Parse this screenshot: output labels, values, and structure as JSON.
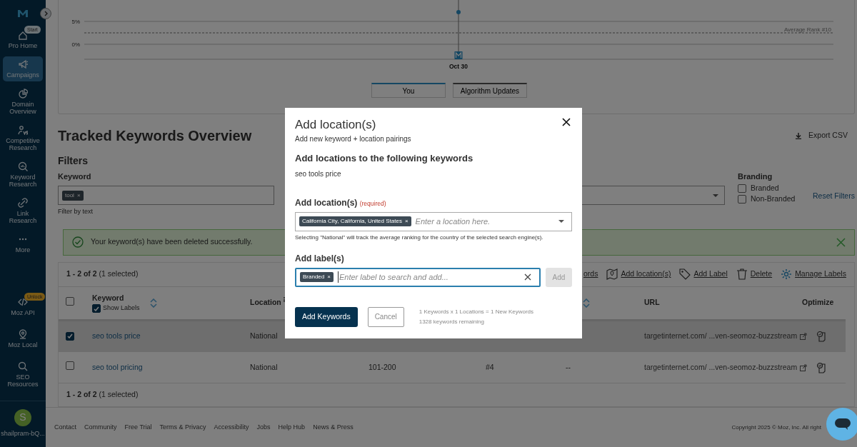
{
  "sidebar": {
    "items": [
      {
        "label": "Pro Home",
        "badge": {
          "text": "Start",
          "highlighted": false
        },
        "selected": false
      },
      {
        "label": "Campaigns",
        "selected": true
      },
      {
        "label": "Domain Overview",
        "selected": false
      },
      {
        "label": "Competitive Research",
        "selected": false
      },
      {
        "label": "Keyword Research",
        "selected": false
      },
      {
        "label": "Link Research",
        "selected": false
      },
      {
        "label": "More",
        "selected": false
      }
    ],
    "bottom_items": [
      {
        "label": "Moz API",
        "badge": {
          "text": "Unlock",
          "highlighted": true
        },
        "selected": false
      },
      {
        "label": "Moz Local",
        "selected": false
      },
      {
        "label": "SEO Resources",
        "selected": false
      }
    ],
    "user": {
      "initial": "S",
      "name": "shailpram-bQ..."
    }
  },
  "chart": {
    "y_ticks": [
      "5%",
      "0%"
    ],
    "date": "Oct 30",
    "reference_label": "Average Rank #10",
    "legend": [
      {
        "label": "You",
        "selected": true
      },
      {
        "label": "Algorithm Updates",
        "selected": false
      }
    ]
  },
  "page": {
    "title": "Tracked Keywords Overview",
    "export": "Export CSV"
  },
  "filters": {
    "heading": "Filters",
    "keyword": {
      "label": "Keyword",
      "chips": [
        {
          "text": "tool",
          "remove": "×"
        }
      ],
      "hint": "Filter by text"
    },
    "branding": {
      "label": "Branding",
      "options": [
        {
          "label": "Branded",
          "checked": false
        },
        {
          "label": "Non-Branded",
          "checked": false
        }
      ]
    },
    "reset": "Reset Filters"
  },
  "alert": {
    "message": "Your keyword(s) have been deleted successfully."
  },
  "table": {
    "count": "1 - 2 of 2",
    "selected_count": "(1 selected)",
    "toolbar": [
      {
        "label": "ords"
      },
      {
        "label": "Add location(s)"
      },
      {
        "label": "Add Label"
      },
      {
        "label": "Delete"
      },
      {
        "label": "Manage Labels"
      }
    ],
    "all_checked": false,
    "show_labels": {
      "label": "Show Labels",
      "checked": true
    },
    "columns": [
      "Keyword",
      "Location",
      "URL",
      "Optimize"
    ],
    "rows": [
      {
        "selected": true,
        "keyword": "seo tools price",
        "location": "National",
        "url": "targetinternet.com/ ...ven-seomoz-buzzstream"
      },
      {
        "selected": false,
        "keyword": "seo tool pricing",
        "location": "National",
        "rank_range": "101-200",
        "rank": "#4",
        "change": "--",
        "url": "targetinternet.com/ ...ven-seomoz-buzzstream"
      }
    ],
    "footer_count": "1 - 2 of 2",
    "footer_selected": "(1 selected)"
  },
  "footer": {
    "links": [
      "Contact",
      "Community",
      "Free Trial",
      "Terms & Privacy",
      "Accessibility",
      "Jobs",
      "Help Hub",
      "News & Press"
    ],
    "copyright": "Copyright 2025 © Moz, Inc. All right"
  },
  "modal": {
    "title": "Add location(s)",
    "subtitle": "Add new keyword + location pairings",
    "keywords_heading": "Add locations to the following keywords",
    "keywords": [
      "seo tools price"
    ],
    "location": {
      "label": "Add location(s)",
      "required": "(required)",
      "chips": [
        {
          "text": "California City, California, United States",
          "remove": "×"
        }
      ],
      "placeholder": "Enter a location here.",
      "help": "Selecting \"National\" will track the average ranking for the country of the selected search engine(s)."
    },
    "labels": {
      "label": "Add label(s)",
      "chips": [
        {
          "text": "Branded",
          "remove": "×"
        }
      ],
      "placeholder": "Enter label to search and add...",
      "add": "Add",
      "add_disabled": true
    },
    "primary": "Add Keywords",
    "cancel": "Cancel",
    "summary": [
      "1 Keywords x 1 Locations = 1 New Keywords",
      "1328 keywords remaining"
    ]
  }
}
